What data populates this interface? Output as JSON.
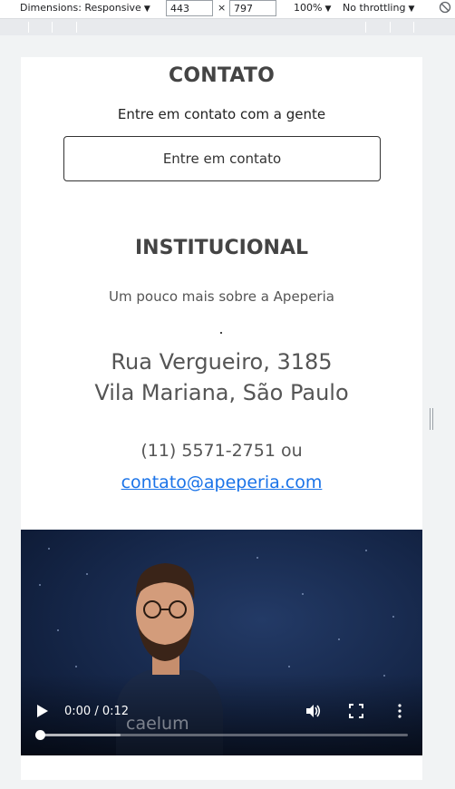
{
  "devtools": {
    "dimensions_label": "Dimensions: Responsive",
    "width_value": "443",
    "times_sign": "×",
    "height_value": "797",
    "zoom_label": "100%",
    "throttling_label": "No throttling",
    "caret": "▼"
  },
  "contato": {
    "title": "CONTATO",
    "subtitle": "Entre em contato com a gente",
    "button_label": "Entre em contato"
  },
  "institucional": {
    "title": "INSTITUCIONAL",
    "subtitle": "Um pouco mais sobre a Apeperia",
    "address_line1": "Rua Vergueiro, 3185",
    "address_line2": "Vila Mariana, São Paulo",
    "phone": "(11) 5571-2751 ou",
    "email": "contato@apeperia.com"
  },
  "video": {
    "time": "0:00 / 0:12",
    "watermark": "caelum",
    "progress_fraction": 0.0,
    "buffered_fraction": 0.22
  },
  "colors": {
    "heading": "#444444",
    "link": "#1a73e8",
    "video_bg": "#152648"
  }
}
